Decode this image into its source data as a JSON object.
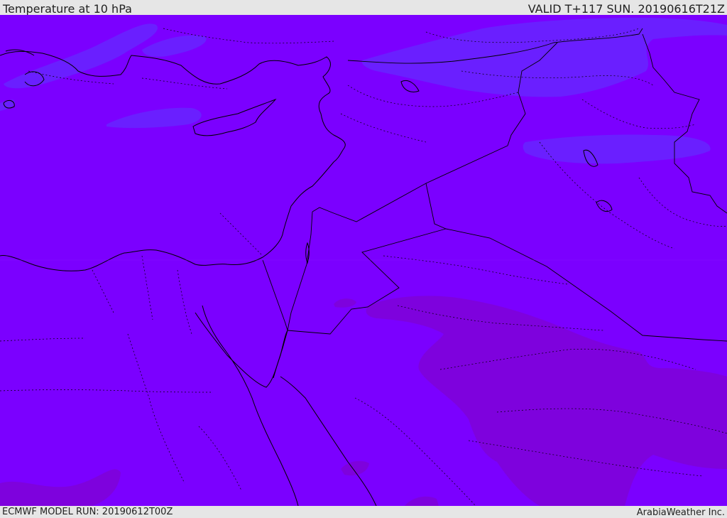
{
  "header": {
    "title": "Temperature at 10 hPa",
    "valid_time": "VALID T+117 SUN. 20190616T21Z"
  },
  "footer": {
    "model_run": "ECMWF MODEL RUN: 20190612T00Z",
    "provider": "ArabiaWeather Inc."
  },
  "colors": {
    "base_field": "#7b00ff",
    "cool_field": "#6a1fff",
    "warm_field": "#7e02dd",
    "coastline": "#000000",
    "chrome": "#e6e6e6"
  }
}
